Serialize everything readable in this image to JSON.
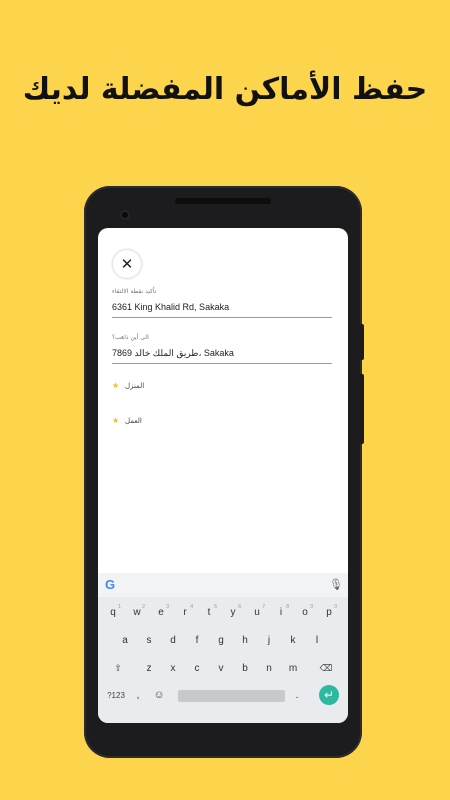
{
  "headline": "حفظ الأماكن المفضلة لديك",
  "form": {
    "close_icon_glyph": "✕",
    "pickup": {
      "label": "تأكيد نقطة الالتقاء",
      "value": "6361 King Khalid Rd, Sakaka"
    },
    "destination": {
      "label": "الى أين ذاهب؟",
      "value": "7869 طريق الملك خالد، Sakaka"
    }
  },
  "favorites": [
    {
      "icon": "star-icon",
      "label": "المنزل"
    },
    {
      "icon": "star-icon",
      "label": "العمل"
    }
  ],
  "keyboard": {
    "google_logo": "G",
    "mic_glyph": "🎙",
    "row1": [
      "q",
      "w",
      "e",
      "r",
      "t",
      "y",
      "u",
      "i",
      "o",
      "p"
    ],
    "row1_hints": [
      "1",
      "2",
      "3",
      "4",
      "5",
      "6",
      "7",
      "8",
      "9",
      "0"
    ],
    "row2": [
      "a",
      "s",
      "d",
      "f",
      "g",
      "h",
      "j",
      "k",
      "l"
    ],
    "row3": [
      "z",
      "x",
      "c",
      "v",
      "b",
      "n",
      "m"
    ],
    "shift_glyph": "⇧",
    "backspace_glyph": "⌫",
    "symbols_label": "?123",
    "emoji_glyph": "☺",
    "comma": ",",
    "period": ".",
    "enter_glyph": "↵"
  },
  "colors": {
    "background": "#fdd54c",
    "star": "#f3bd1c",
    "enter": "#2fb8a0"
  }
}
